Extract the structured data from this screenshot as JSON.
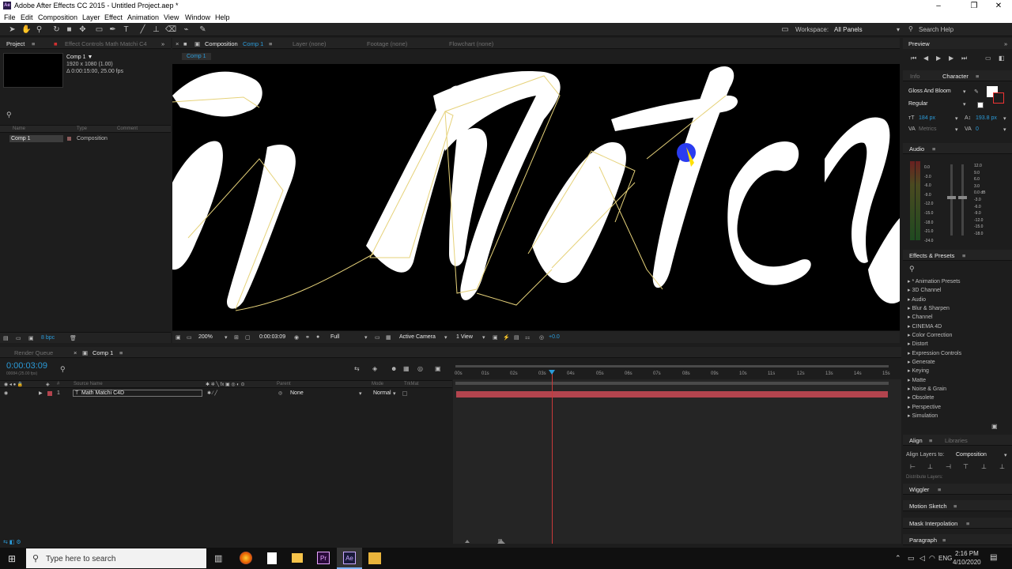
{
  "window": {
    "title": "Adobe After Effects CC 2015 - Untitled Project.aep *",
    "logo_text": "Ae"
  },
  "menu": [
    "File",
    "Edit",
    "Composition",
    "Layer",
    "Effect",
    "Animation",
    "View",
    "Window",
    "Help"
  ],
  "toolbar": {
    "workspace_label": "Workspace:",
    "workspace_value": "All Panels",
    "search_placeholder": "Search Help"
  },
  "project": {
    "tab": "Project",
    "effect_controls_tab": "Effect Controls Math Matchi C4",
    "comp_name": "Comp 1 ▼",
    "comp_res": "1920 x 1080 (1.00)",
    "comp_dur": "Δ 0:00:15:00, 25.00 fps",
    "search_icon": "search-icon",
    "col_name": "Name",
    "col_type": "Type",
    "col_comment": "Comment",
    "item_name": "Comp 1",
    "item_type": "Composition",
    "bpc": "8 bpc"
  },
  "composition": {
    "tab_prefix": "Composition",
    "tab_comp": "Comp 1",
    "layer_tab": "Layer (none)",
    "footage_tab": "Footage (none)",
    "flowchart_tab": "Flowchart (none)",
    "breadcrumb": "Comp 1",
    "zoom": "200%",
    "timecode": "0:00:03:09",
    "resolution": "Full",
    "camera": "Active Camera",
    "views": "1 View",
    "exposure": "+0.0"
  },
  "preview": {
    "tab": "Preview"
  },
  "character": {
    "info_tab": "Info",
    "tab": "Character",
    "font": "Gloss And Bloom",
    "style": "Regular",
    "size": "184 px",
    "leading": "193.8 px",
    "kerning": "Metrics",
    "tracking": "0"
  },
  "audio": {
    "tab": "Audio",
    "left_scale": [
      "0.0",
      "-3.0",
      "-6.0",
      "-9.0",
      "-12.0",
      "-15.0",
      "-18.0",
      "-21.0",
      "-24.0"
    ],
    "right_scale": [
      "12.0 dB",
      "6.0",
      "0.0 dB",
      "-6.0",
      "-12.0",
      "-18.0",
      "-24.0"
    ],
    "right_scale_extra": [
      "12.0",
      "9.0",
      "3.0",
      "0.0",
      "-3.0",
      "-9.0",
      "-15.0",
      "-21.0"
    ]
  },
  "effects": {
    "tab": "Effects & Presets",
    "items": [
      "* Animation Presets",
      "3D Channel",
      "Audio",
      "Blur & Sharpen",
      "Channel",
      "CINEMA 4D",
      "Color Correction",
      "Distort",
      "Expression Controls",
      "Generate",
      "Keying",
      "Matte",
      "Noise & Grain",
      "Obsolete",
      "Perspective",
      "Simulation"
    ]
  },
  "align": {
    "tab": "Align",
    "libraries_tab": "Libraries",
    "align_to_label": "Align Layers to:",
    "align_to_value": "Composition",
    "distribute": "Distribute Layers:"
  },
  "stacked_panels": [
    "Wiggler",
    "Motion Sketch",
    "Mask Interpolation",
    "Paragraph"
  ],
  "timeline": {
    "render_queue_tab": "Render Queue",
    "comp_tab": "Comp 1",
    "timecode": "0:00:03:09",
    "frame_info": "00084 (25.00 fps)",
    "col_source": "Source Name",
    "col_parent": "Parent",
    "col_mode": "Mode",
    "col_trkmat": "TrkMat",
    "layer_index": "1",
    "layer_name": "Math Matchi C4D",
    "layer_parent": "None",
    "layer_mode": "Normal",
    "ruler": [
      "00s",
      "01s",
      "02s",
      "03s",
      "04s",
      "05s",
      "06s",
      "07s",
      "08s",
      "09s",
      "10s",
      "11s",
      "12s",
      "13s",
      "14s",
      "15s"
    ]
  },
  "taskbar": {
    "search_placeholder": "Type here to search",
    "lang": "ENG",
    "time": "2:16 PM",
    "date": "4/10/2020",
    "ae_label": "Ae",
    "pr_label": "Pr"
  },
  "colors": {
    "accent": "#2b9bd9",
    "layer_bar": "#b3444e",
    "playhead": "#c83a3a",
    "mask_path": "#e6d27a"
  }
}
